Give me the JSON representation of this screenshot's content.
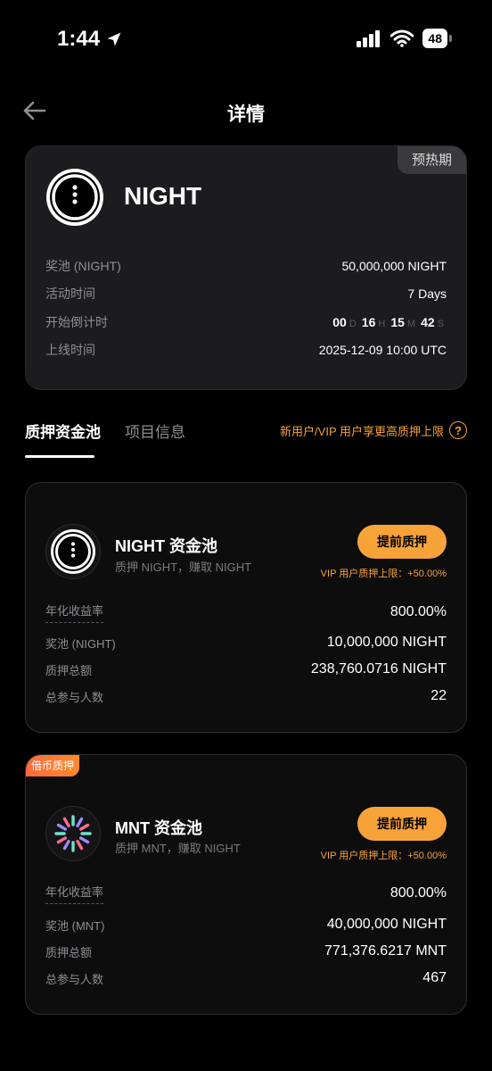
{
  "status": {
    "time": "1:44",
    "battery": "48"
  },
  "header": {
    "title": "详情"
  },
  "token": {
    "name": "NIGHT",
    "phase": "预热期",
    "rows": [
      {
        "label": "奖池 (NIGHT)",
        "value": "50,000,000 NIGHT"
      },
      {
        "label": "活动时间",
        "value": "7 Days"
      },
      {
        "label": "开始倒计时"
      },
      {
        "label": "上线时间",
        "value": "2025-12-09 10:00 UTC"
      }
    ],
    "countdown": {
      "d": "00",
      "d_unit": "D",
      "h": "16",
      "h_unit": "H",
      "m": "15",
      "m_unit": "M",
      "s": "42",
      "s_unit": "S"
    }
  },
  "tabs": [
    {
      "label": "质押资金池",
      "active": true
    },
    {
      "label": "项目信息",
      "active": false
    }
  ],
  "tab_note": "新用户/VIP 用户享更高质押上限",
  "pools": [
    {
      "name": "NIGHT 资金池",
      "subtitle": "质押 NIGHT，赚取 NIGHT",
      "button": "提前质押",
      "vip_limit": "VIP 用户质押上限：+50.00%",
      "rows": [
        {
          "label": "年化收益率",
          "value": "800.00%"
        },
        {
          "label": "奖池 (NIGHT)",
          "value": "10,000,000 NIGHT"
        },
        {
          "label": "质押总额",
          "value": "238,760.0716 NIGHT"
        },
        {
          "label": "总参与人数",
          "value": "22"
        }
      ]
    },
    {
      "tag": "借币质押",
      "name": "MNT 资金池",
      "subtitle": "质押 MNT，赚取 NIGHT",
      "button": "提前质押",
      "vip_limit": "VIP 用户质押上限：+50.00%",
      "rows": [
        {
          "label": "年化收益率",
          "value": "800.00%"
        },
        {
          "label": "奖池 (MNT)",
          "value": "40,000,000 NIGHT"
        },
        {
          "label": "质押总额",
          "value": "771,376.6217 MNT"
        },
        {
          "label": "总参与人数",
          "value": "467"
        }
      ]
    }
  ],
  "colors": {
    "accent": "#f7a33a",
    "card": "#1c1c1e",
    "muted": "#8e8e93"
  }
}
